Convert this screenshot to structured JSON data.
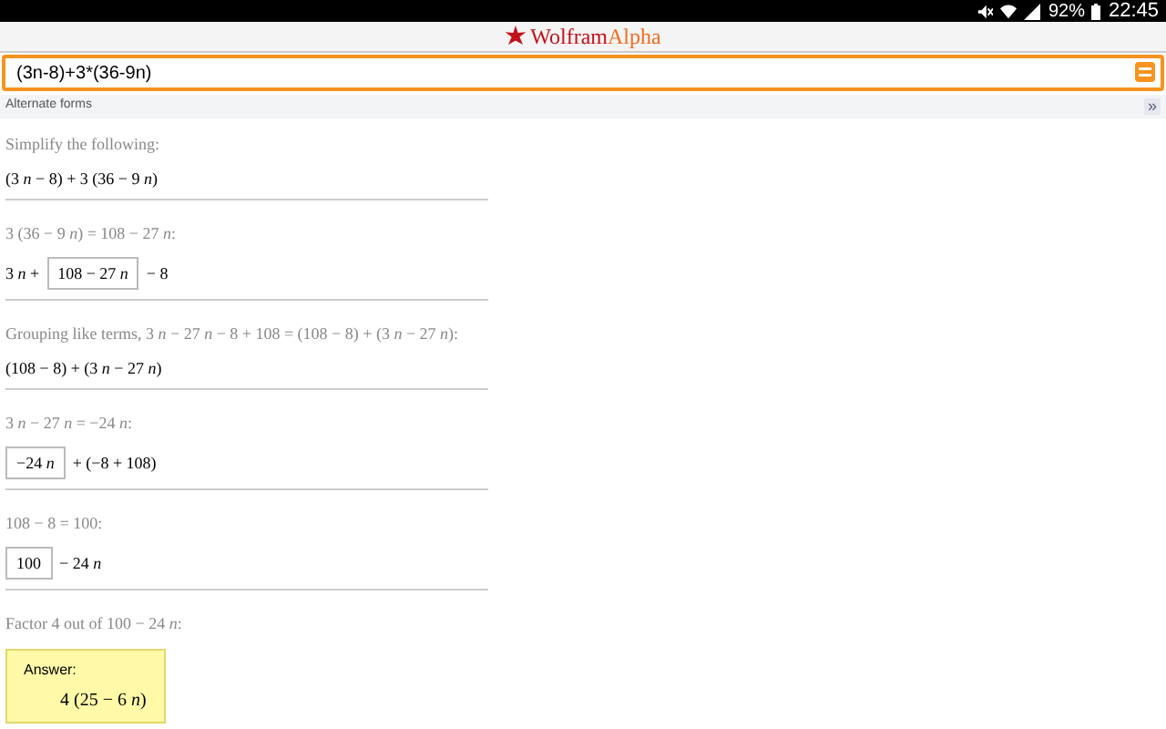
{
  "status_bar": {
    "battery": "92%",
    "time": "22:45"
  },
  "logo": {
    "part_1": "Wolfram",
    "part_2": "Alpha"
  },
  "query": {
    "value": "(3n-8)+3*(36-9n)"
  },
  "pod": {
    "title": "Alternate forms",
    "more": "»"
  },
  "steps": [
    {
      "caption": "Simplify the following:",
      "parts": [
        {
          "kind": "text",
          "text": "(3 *n* − 8) + 3 (36 − 9 *n*)"
        }
      ]
    },
    {
      "caption": "3 (36 − 9 *n*) = 108 − 27 *n*:",
      "parts": [
        {
          "kind": "text",
          "text": "3 *n* +"
        },
        {
          "kind": "boxed",
          "text": "108 − 27 *n*"
        },
        {
          "kind": "text",
          "text": "− 8"
        }
      ]
    },
    {
      "caption": "Grouping like terms, 3 *n* − 27 *n* − 8 + 108 = (108 − 8) + (3 *n* − 27 *n*):",
      "parts": [
        {
          "kind": "text",
          "text": "(108 − 8) + (3 *n* − 27 *n*)"
        }
      ]
    },
    {
      "caption": "3 *n* − 27 *n* = −24 *n*:",
      "parts": [
        {
          "kind": "boxed",
          "text": "−24 *n*"
        },
        {
          "kind": "text",
          "text": "+ (−8 + 108)"
        }
      ]
    },
    {
      "caption": "108 − 8 = 100:",
      "parts": [
        {
          "kind": "boxed",
          "text": "100"
        },
        {
          "kind": "text",
          "text": "− 24 *n*"
        }
      ]
    }
  ],
  "final": {
    "caption": "Factor 4 out of 100 − 24 *n*:",
    "label": "Answer:",
    "answer": "4 (25 − 6 *n*)"
  }
}
